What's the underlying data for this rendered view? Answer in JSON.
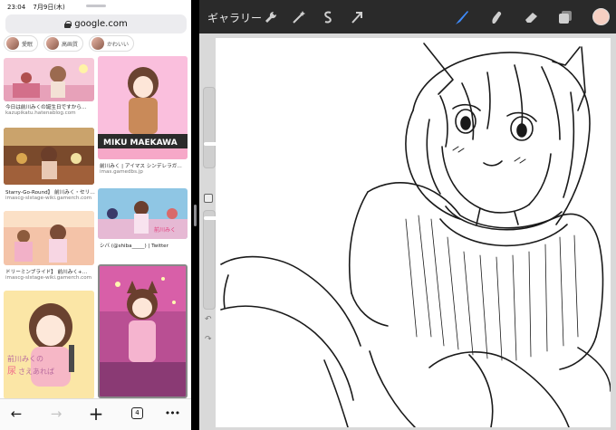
{
  "status_bar": {
    "time": "23:04",
    "date": "7月9日(木)"
  },
  "browser": {
    "url": "google.com",
    "chips": [
      "愛眠",
      "高画質",
      "かわいい"
    ],
    "results": [
      {
        "title": "今日は前川みくの誕生日ですから…",
        "source": "kazupikatu.hatenablog.com"
      },
      {
        "title": "Starry-Go-Round】 前川みく・セリ…",
        "source": "imascg-slstage-wiki.gamerch.com"
      },
      {
        "title": "ドリーミンブライド】 前川みく+…",
        "source": "imascg-slstage-wiki.gamerch.com"
      },
      {
        "title": "前川みく | アイマス シンデレラガ…",
        "source": "imas.gamedbs.jp"
      },
      {
        "title": "シバ (@shiba_____) | Twitter",
        "source": ""
      }
    ],
    "image_text": {
      "banner": "MIKU MAEKAWA",
      "caption_line1": "前川みくの",
      "caption_line2_a": "尿",
      "caption_line2_b": "さえあれば",
      "small_tag": "前川みく"
    },
    "toolbar": {
      "back": "←",
      "forward": "→",
      "new_tab": "+",
      "tab_count": "4",
      "more": "•••"
    }
  },
  "procreate": {
    "gallery_label": "ギャラリー",
    "left_tools": [
      "wrench-icon",
      "magic-wand-icon",
      "selection-icon",
      "transform-arrow-icon"
    ],
    "right_tools": [
      "brush-icon",
      "smudge-icon",
      "eraser-icon",
      "layers-icon"
    ],
    "colors": {
      "active_tool": "#3f8cff",
      "toolbar_bg": "#2a2a2a",
      "swatch": "#f6cfc2"
    },
    "sidebar": {
      "undo": "↶",
      "redo": "↷"
    }
  }
}
